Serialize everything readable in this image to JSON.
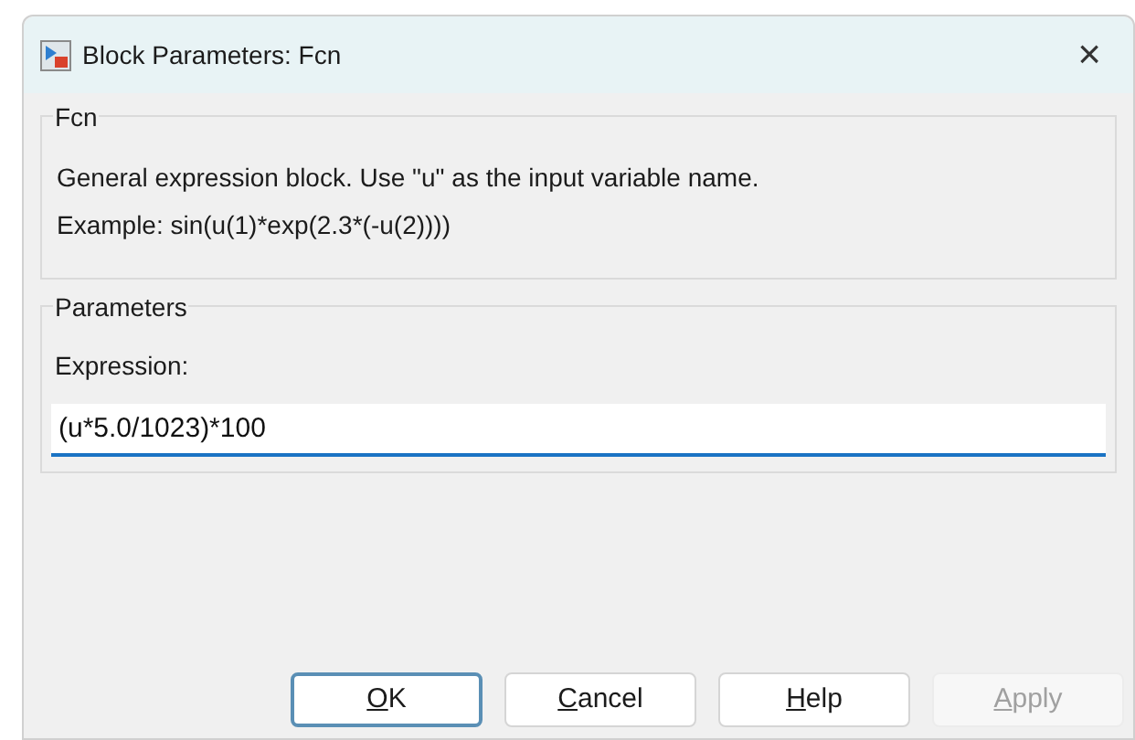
{
  "window": {
    "title": "Block Parameters: Fcn",
    "close": "×"
  },
  "description_group": {
    "title": "Fcn",
    "lines": [
      "General expression block. Use \"u\" as the input variable name.",
      "Example: sin(u(1)*exp(2.3*(-u(2))))"
    ]
  },
  "parameters_group": {
    "title": "Parameters",
    "fields": [
      {
        "label": "Expression:",
        "value": "(u*5.0/1023)*100"
      }
    ]
  },
  "buttons": [
    {
      "key": "O",
      "rest": "K",
      "default": true,
      "disabled": false
    },
    {
      "key": "C",
      "rest": "ancel",
      "default": false,
      "disabled": false
    },
    {
      "key": "H",
      "rest": "elp",
      "default": false,
      "disabled": false
    },
    {
      "key": "A",
      "rest": "pply",
      "default": false,
      "disabled": true
    }
  ]
}
